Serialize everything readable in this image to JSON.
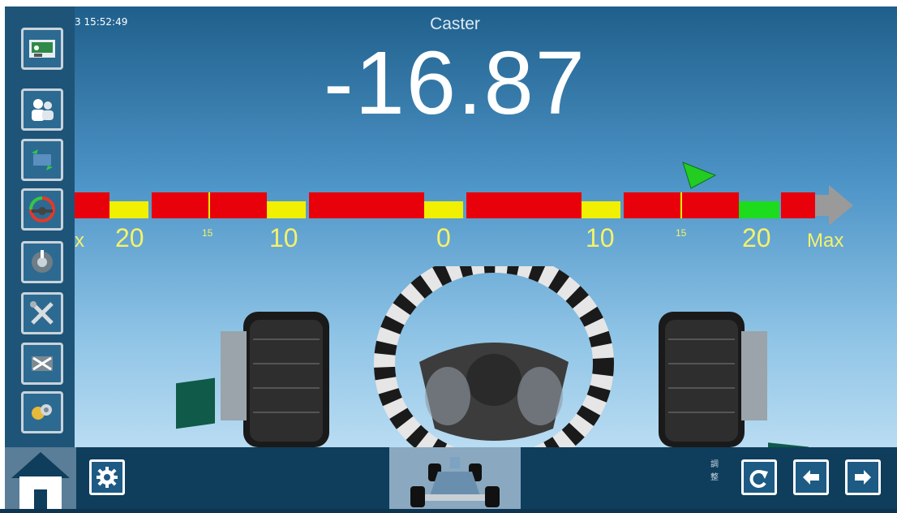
{
  "clock": "3 15:52:49",
  "title": "Caster",
  "value": "-16.87",
  "scale": {
    "tick_labels": {
      "left_edge": "x",
      "left_20": "20",
      "left_15": "15",
      "left_10": "10",
      "center_0": "0",
      "right_10": "10",
      "right_15": "15",
      "right_20": "20",
      "max": "Max"
    },
    "colors": {
      "out_of_range": "#e8000a",
      "warning": "#f0f000",
      "in_spec": "#1ddc1d",
      "tick_text": "#f5f26a",
      "arrow": "#9a9a9a",
      "pointer": "#22cc22"
    }
  },
  "sidebar": {
    "items": [
      {
        "name": "vehicle-data-icon"
      },
      {
        "name": "customer-icon"
      },
      {
        "name": "runout-compensation-icon"
      },
      {
        "name": "steering-wheel-icon"
      },
      {
        "name": "measurement-icon"
      },
      {
        "name": "tools-icon"
      },
      {
        "name": "adjustment-icon"
      },
      {
        "name": "extras-icon"
      }
    ]
  },
  "bottom": {
    "side_text": "調\n整"
  }
}
